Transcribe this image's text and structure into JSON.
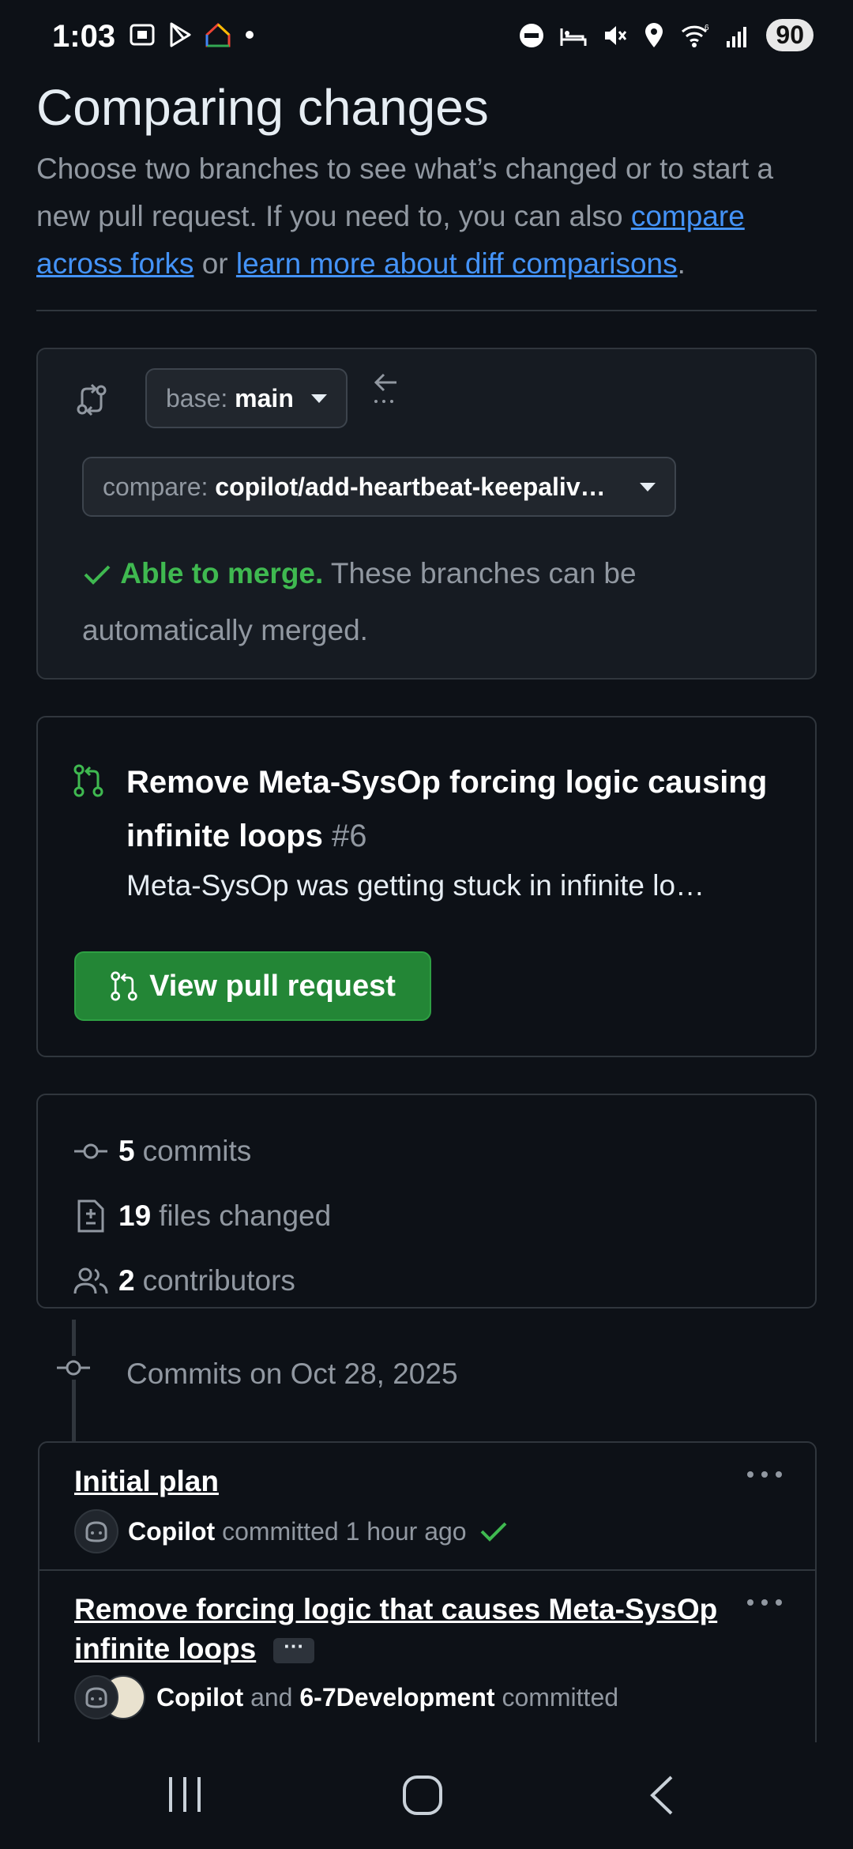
{
  "status_bar": {
    "time": "1:03",
    "battery": "90",
    "icons_left": [
      "screenshot-icon",
      "play-store-icon",
      "home-icon",
      "dot-icon"
    ],
    "icons_right": [
      "dnd-icon",
      "sleep-icon",
      "mute-icon",
      "location-icon",
      "wifi-icon",
      "signal-icon",
      "battery-icon"
    ]
  },
  "page": {
    "title": "Comparing changes",
    "intro_1": "Choose two branches to see what’s changed or to start a new pull request. If you need to, you can also ",
    "link_forks": "compare across forks",
    "intro_or": " or ",
    "link_learn": "learn more about diff comparisons",
    "intro_end": "."
  },
  "branches": {
    "base_prefix": "base:",
    "base_value": "main",
    "compare_prefix": "compare:",
    "compare_value": "copilot/add-heartbeat-keepaliv…",
    "merge_ok": "Able to merge.",
    "merge_text": " These branches can be automatically merged."
  },
  "pull_request": {
    "title": "Remove Meta-SysOp forcing logic causing infinite loops",
    "number": "#6",
    "description": "Meta-SysOp was getting stuck in infinite lo…",
    "view_button": "View pull request"
  },
  "stats": {
    "commits_num": "5",
    "commits_label": "commits",
    "files_num": "19",
    "files_label": "files changed",
    "contributors_num": "2",
    "contributors_label": "contributors"
  },
  "timeline": {
    "heading": "Commits on Oct 28, 2025"
  },
  "commits": [
    {
      "title": "Initial plan",
      "author": "Copilot",
      "meta": "committed 1 hour ago"
    },
    {
      "title": "Remove forcing logic that causes Meta-SysOp infinite loops",
      "ellipsis": "···",
      "author": "Copilot",
      "and": "and",
      "coauthor": "6-7Development",
      "meta": "committed"
    }
  ],
  "colors": {
    "background": "#0d1117",
    "link": "#4493f8",
    "success": "#3fb950",
    "button_green": "#238636"
  }
}
